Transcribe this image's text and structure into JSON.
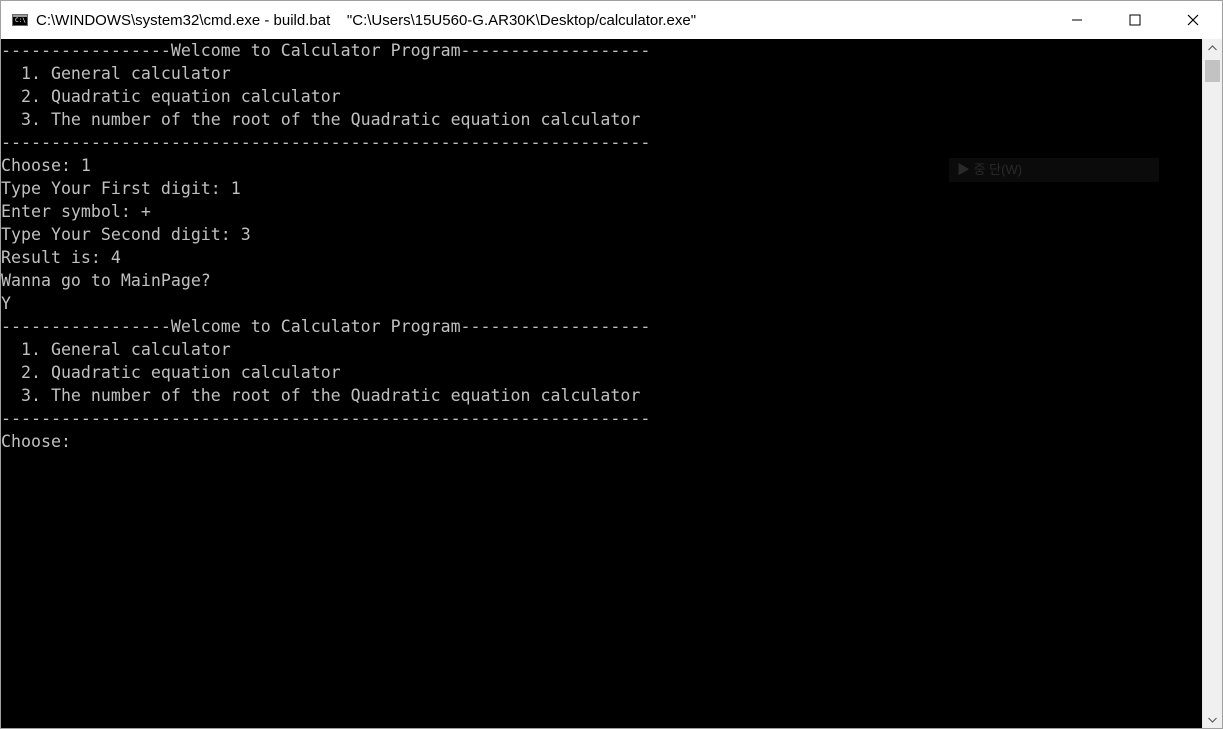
{
  "window": {
    "title": "C:\\WINDOWS\\system32\\cmd.exe - build.bat    \"C:\\Users\\15U560-G.AR30K\\Desktop/calculator.exe\"",
    "icon": "cmd-icon",
    "icon_glyph": "C:\\",
    "controls": [
      "minimize-icon",
      "maximize-icon",
      "close-icon"
    ]
  },
  "console": {
    "text_color": "#c0c0c0",
    "background": "#000000",
    "lines": [
      "-----------------Welcome to Calculator Program-------------------",
      "  1. General calculator",
      "  2. Quadratic equation calculator",
      "  3. The number of the root of the Quadratic equation calculator",
      "-----------------------------------------------------------------",
      "Choose: 1",
      "Type Your First digit: 1",
      "Enter symbol: +",
      "Type Your Second digit: 3",
      "Result is: 4",
      "Wanna go to MainPage?",
      "Y",
      "-----------------Welcome to Calculator Program-------------------",
      "  1. General calculator",
      "  2. Quadratic equation calculator",
      "  3. The number of the root of the Quadratic equation calculator",
      "-----------------------------------------------------------------",
      "Choose: "
    ]
  },
  "ghost_overlay": {
    "text": "▶  중  단(W)"
  },
  "scrollbar": {
    "up_icon": "scroll-up-arrow-icon",
    "down_icon": "scroll-down-arrow-icon"
  }
}
